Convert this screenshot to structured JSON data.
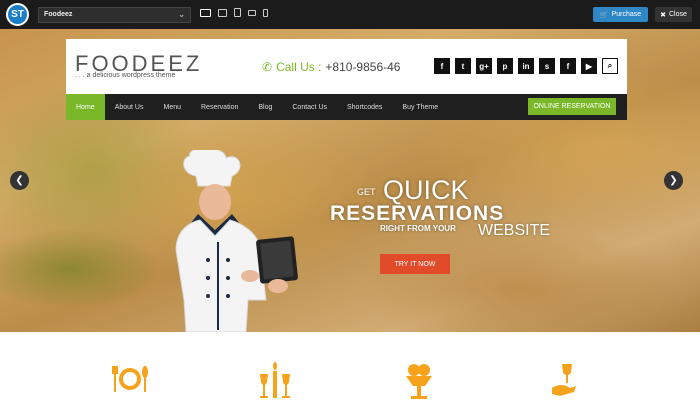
{
  "toolbar": {
    "logo_text": "ST",
    "theme_name": "Foodeez",
    "purchase_label": "Purchase",
    "close_label": "Close"
  },
  "site": {
    "logo": "FOODEEZ",
    "tagline": ". . . a delicious wordpress theme",
    "phone_label": "Call Us :",
    "phone_number": "+810-9856-46"
  },
  "social_icons": [
    "facebook-icon",
    "twitter-icon",
    "google-plus-icon",
    "pinterest-icon",
    "linkedin-icon",
    "foursquare-icon",
    "flickr-icon",
    "youtube-icon",
    "search-icon"
  ],
  "social_glyphs": [
    "f",
    "t",
    "g+",
    "p",
    "in",
    "s",
    "f",
    "▶",
    "⌕"
  ],
  "nav": {
    "items": [
      "Home",
      "About Us",
      "Menu",
      "Reservation",
      "Blog",
      "Contact Us",
      "Shortcodes",
      "Buy Theme"
    ],
    "cta": "ONLINE RESERVATION"
  },
  "hero": {
    "line1_small": "GET",
    "line1_big": "QUICK",
    "line2": "RESERVATIONS",
    "line3_bold": "RIGHT FROM YOUR",
    "line3_light": "WEBSITE",
    "button": "TRY IT NOW"
  },
  "colors": {
    "accent": "#7ab829",
    "cta_red": "#e14b2a",
    "feature_orange": "#f7a21b"
  }
}
